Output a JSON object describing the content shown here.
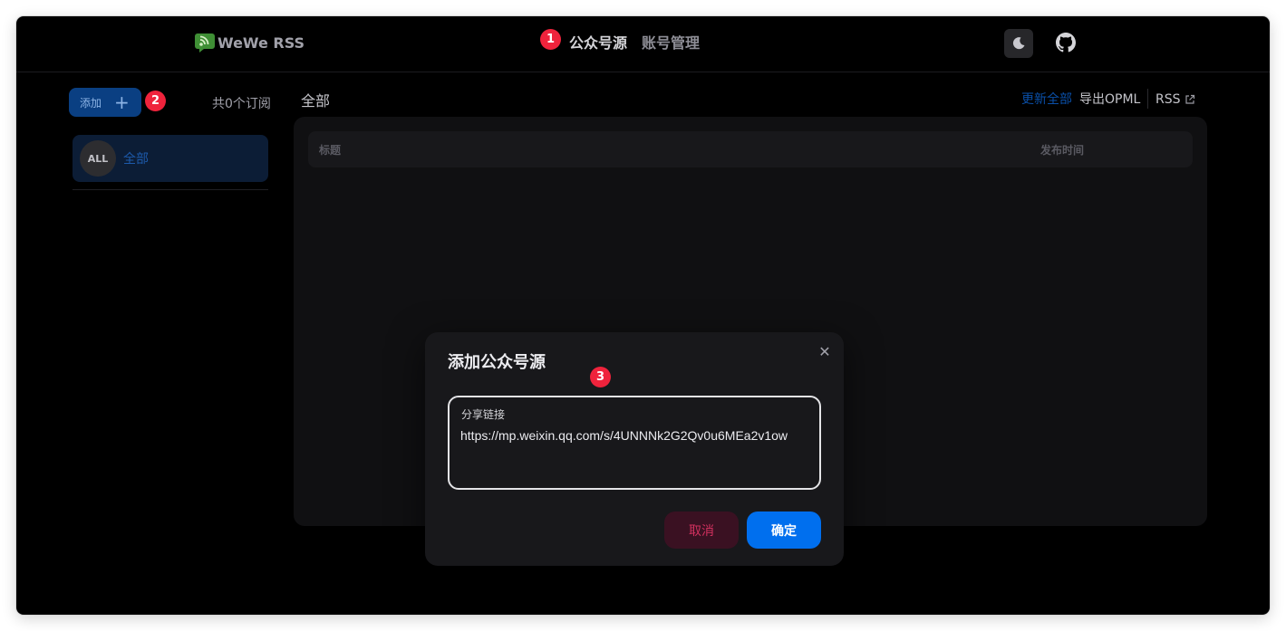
{
  "app": {
    "brand": "WeWe RSS"
  },
  "nav": {
    "feeds_label": "公众号源",
    "accounts_label": "账号管理"
  },
  "header": {
    "theme_icon": "moon-icon",
    "github_icon": "github-icon"
  },
  "markers": [
    "1",
    "2",
    "3"
  ],
  "sidebar": {
    "add_label": "添加",
    "add_icon": "plus-icon",
    "subscription_count": "共0个订阅",
    "feeds": [
      {
        "avatar": "ALL",
        "label": "全部"
      }
    ]
  },
  "main": {
    "title": "全部",
    "actions": {
      "update_all": "更新全部",
      "export_opml": "导出OPML",
      "rss": "RSS"
    },
    "table": {
      "columns": [
        "标题",
        "发布时间"
      ],
      "rows": []
    }
  },
  "modal": {
    "title": "添加公众号源",
    "field_label": "分享链接",
    "field_value": "https://mp.weixin.qq.com/s/4UNNNk2G2Qv0u6MEa2v1ow",
    "cancel_label": "取消",
    "confirm_label": "确定"
  },
  "colors": {
    "accent": "#006fee",
    "danger": "#d0305e",
    "marker": "#ef233c",
    "background": "#000000"
  }
}
